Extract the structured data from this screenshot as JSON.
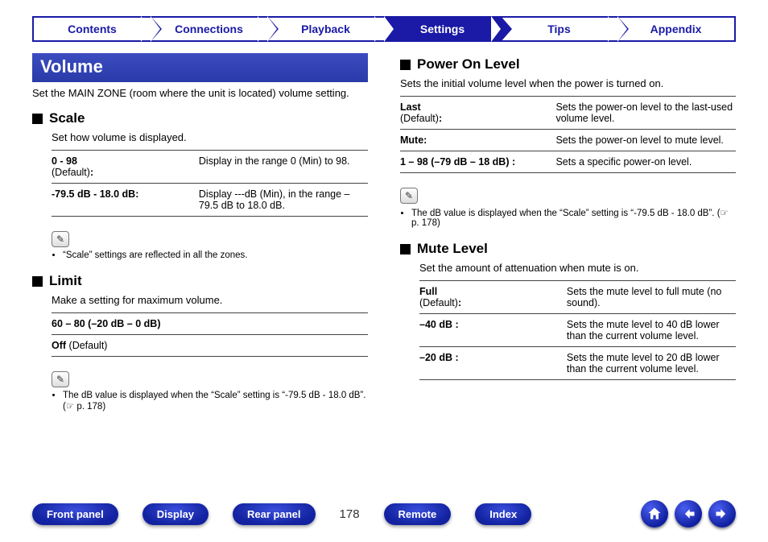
{
  "tabs": [
    "Contents",
    "Connections",
    "Playback",
    "Settings",
    "Tips",
    "Appendix"
  ],
  "active_tab_index": 3,
  "page_number": "178",
  "section_title": "Volume",
  "section_intro": "Set the MAIN ZONE (room where the unit is located) volume setting.",
  "scale": {
    "heading": "Scale",
    "desc": "Set how volume is displayed.",
    "rows": [
      {
        "name": "0 - 98",
        "def": "(Default)",
        "desc": "Display in the range 0 (Min) to 98."
      },
      {
        "name": "-79.5 dB - 18.0 dB:",
        "desc": "Display ---dB (Min), in the range –79.5 dB to 18.0 dB."
      }
    ],
    "note": "“Scale” settings are reflected in all the zones."
  },
  "limit": {
    "heading": "Limit",
    "desc": "Make a setting for maximum volume.",
    "rows": [
      {
        "name": "60 – 80 (–20 dB – 0 dB)"
      },
      {
        "name_bold": "Off",
        "name_plain": " (Default)"
      }
    ],
    "note_prefix": "The dB value is displayed when the “Scale” setting is “-79.5 dB - 18.0 dB”. (",
    "note_ref": "☞ p. 178",
    "note_suffix": ")"
  },
  "power": {
    "heading": "Power On Level",
    "desc": "Sets the initial volume level when the power is turned on.",
    "rows": [
      {
        "name": "Last",
        "def": "(Default)",
        "desc": "Sets the power-on level to the last-used volume level."
      },
      {
        "name": "Mute:",
        "desc": "Sets the power-on level to mute level."
      },
      {
        "name": "1 – 98 (–79 dB – 18 dB) :",
        "desc": "Sets a specific power-on level."
      }
    ],
    "note_prefix": "The dB value is displayed when the “Scale” setting is “-79.5 dB - 18.0 dB”. (",
    "note_ref": "☞ p. 178",
    "note_suffix": ")"
  },
  "mute": {
    "heading": "Mute Level",
    "desc": "Set the amount of attenuation when mute is on.",
    "rows": [
      {
        "name": "Full",
        "def": "(Default)",
        "desc": "Sets the mute level to full mute (no sound)."
      },
      {
        "name": "–40 dB :",
        "desc": "Sets the mute level to 40 dB lower than the current volume level."
      },
      {
        "name": "–20 dB :",
        "desc": "Sets the mute level to 20 dB lower than the current volume level."
      }
    ]
  },
  "bottom_nav": [
    "Front panel",
    "Display",
    "Rear panel",
    "Remote",
    "Index"
  ]
}
